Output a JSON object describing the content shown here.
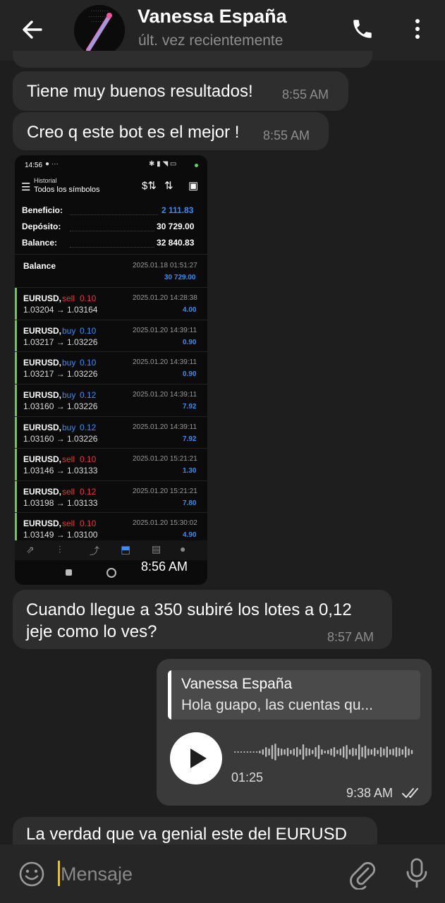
{
  "header": {
    "title": "Vanessa España",
    "subtitle": "últ. vez recientemente",
    "back_icon": "arrow-left",
    "call_icon": "phone",
    "menu_icon": "more-vertical"
  },
  "messages": [
    {
      "text": "Tiene muy buenos resultados!",
      "time": "8:55 AM"
    },
    {
      "text": "Creo q este bot es el mejor !",
      "time": "8:55 AM"
    },
    {
      "time": "8:56 AM"
    },
    {
      "line1": "Cuando llegue a 350 subiré los lotes a 0,12",
      "line2": "jeje como lo ves?",
      "time": "8:57 AM"
    }
  ],
  "screenshot": {
    "status_time": "14:56",
    "app_title_top": "Historial",
    "app_title_sub": "Todos los símbolos",
    "summary": [
      {
        "label": "Beneficio:",
        "value": "2 111.83",
        "color": "#3b8cf5"
      },
      {
        "label": "Depósito:",
        "value": "30 729.00",
        "color": "#ffffff"
      },
      {
        "label": "Balance:",
        "value": "32 840.83",
        "color": "#ffffff"
      }
    ],
    "balance_row": {
      "label": "Balance",
      "date": "2025.01.18 01:51:27",
      "amount": "30 729.00"
    },
    "trades": [
      {
        "symbol": "EURUSD,",
        "side": "sell",
        "lot": "0.10",
        "prices": "1.03204 → 1.03164",
        "date": "2025.01.20 14:28:38",
        "profit": "4.00"
      },
      {
        "symbol": "EURUSD,",
        "side": "buy",
        "lot": "0.10",
        "prices": "1.03217 → 1.03226",
        "date": "2025.01.20 14:39:11",
        "profit": "0.90"
      },
      {
        "symbol": "EURUSD,",
        "side": "buy",
        "lot": "0.10",
        "prices": "1.03217 → 1.03226",
        "date": "2025.01.20 14:39:11",
        "profit": "0.90"
      },
      {
        "symbol": "EURUSD,",
        "side": "buy",
        "lot": "0.12",
        "prices": "1.03160 → 1.03226",
        "date": "2025.01.20 14:39:11",
        "profit": "7.92"
      },
      {
        "symbol": "EURUSD,",
        "side": "buy",
        "lot": "0.12",
        "prices": "1.03160 → 1.03226",
        "date": "2025.01.20 14:39:11",
        "profit": "7.92"
      },
      {
        "symbol": "EURUSD,",
        "side": "sell",
        "lot": "0.10",
        "prices": "1.03146 → 1.03133",
        "date": "2025.01.20 15:21:21",
        "profit": "1.30"
      },
      {
        "symbol": "EURUSD,",
        "side": "sell",
        "lot": "0.12",
        "prices": "1.03198 → 1.03133",
        "date": "2025.01.20 15:21:21",
        "profit": "7.80"
      },
      {
        "symbol": "EURUSD,",
        "side": "sell",
        "lot": "0.10",
        "prices": "1.03149 → 1.03100",
        "date": "2025.01.20 15:30:02",
        "profit": "4.90"
      }
    ],
    "sell_color": "#e23b3b",
    "buy_color": "#3b8cf5"
  },
  "outgoing": {
    "quote_name": "Vanessa España",
    "quote_text": "Hola guapo, las cuentas qu...",
    "duration": "01:25",
    "time": "9:38 AM",
    "status_icon": "double-check"
  },
  "partial_message": "La verdad que va genial este del EURUSD",
  "composer": {
    "placeholder": "Mensaje",
    "emoji_icon": "smile",
    "attach_icon": "paperclip",
    "mic_icon": "microphone"
  },
  "colors": {
    "background": "#1e1e1e",
    "bubble_in": "#2e2e2e",
    "bubble_out": "#3a3a3a",
    "profit_blue": "#3b8cf5",
    "trade_green": "#7cc244"
  }
}
